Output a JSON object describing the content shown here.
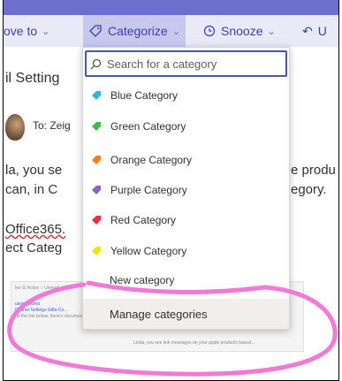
{
  "ribbon": {
    "move_label": "ove to",
    "categorize_label": "Categorize",
    "snooze_label": "Snooze",
    "undo_label": "U"
  },
  "background": {
    "settings_title": "il Setting",
    "to_label": "To: Zeig",
    "line1_left": "la, you se",
    "line1_right": "e produ",
    "line2_left": "can, in C",
    "line2_right": "egory.",
    "link_left": "Office365.",
    "line4_left": "ect Categ",
    "thumb_top": "lee  ☰ Active  ○ Unread",
    "thumb_name": "user, Andrea",
    "thumb_sub": "Course Settings Gilfa-Co...",
    "thumb_note": "ad the link below, there's documents li...",
    "thumb_right": "Linda, you see link messages on your apple products based..."
  },
  "dropdown": {
    "search_placeholder": "Search for a category",
    "categories": [
      {
        "label": "Blue Category",
        "color": "#2fb5e5"
      },
      {
        "label": "Green Category",
        "color": "#44b84a"
      },
      {
        "label": "Orange Category",
        "color": "#f07f1c"
      },
      {
        "label": "Purple Category",
        "color": "#8a63c4"
      },
      {
        "label": "Red Category",
        "color": "#e3353f"
      },
      {
        "label": "Yellow Category",
        "color": "#f4e10c"
      }
    ],
    "new_category": "New category",
    "manage_label": "Manage categories"
  },
  "annotation_color": "#f07bd6"
}
